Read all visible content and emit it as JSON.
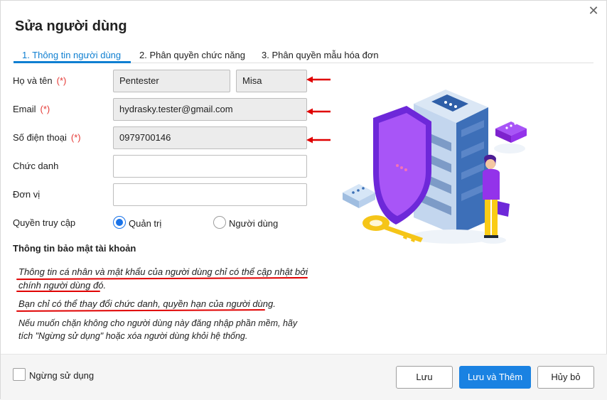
{
  "dialog": {
    "title": "Sửa người dùng"
  },
  "tabs": [
    {
      "label": "1. Thông tin người dùng"
    },
    {
      "label": "2. Phân quyền chức năng"
    },
    {
      "label": "3. Phân quyền mẫu hóa đơn"
    }
  ],
  "form": {
    "name_label": "Họ và tên",
    "email_label": "Email",
    "phone_label": "Số điện thoại",
    "title_label": "Chức danh",
    "unit_label": "Đơn vị",
    "access_label": "Quyền truy cập",
    "required_mark": "(*)",
    "first_name": "Pentester",
    "last_name": "Misa",
    "email": "hydrasky.tester@gmail.com",
    "phone": "0979700146",
    "title_value": "",
    "unit_value": "",
    "access_options": [
      "Quản trị",
      "Người dùng"
    ],
    "access_selected": "Quản trị"
  },
  "security": {
    "heading": "Thông tin bảo mật tài khoản",
    "note1_line1": "Thông tin cá nhân và mật khẩu của người dùng chỉ có thể cập nhật bởi",
    "note1_line2": "chính người dùng đó.",
    "note2": "Bạn chỉ có thể thay đổi chức danh, quyền hạn của người dùng.",
    "note3_line1": "Nếu muốn chặn không cho người dùng này đăng nhập phần mềm, hãy",
    "note3_line2": "tích \"Ngừng sử dụng\" hoặc xóa người dùng khỏi hệ thống."
  },
  "footer": {
    "disable_label": "Ngừng sử dụng",
    "save": "Lưu",
    "save_and_add": "Lưu và Thêm",
    "cancel": "Hủy bỏ"
  },
  "colors": {
    "accent": "#1a82e2",
    "tab_active": "#0f7fd1",
    "required": "#e53935",
    "annotation": "#e00000"
  },
  "icons": [
    "close-icon",
    "security-illustration"
  ]
}
